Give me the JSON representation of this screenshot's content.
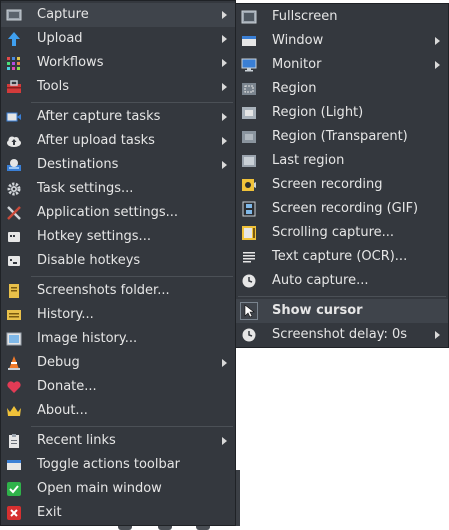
{
  "main_menu": {
    "items": [
      {
        "label": "Capture",
        "icon": "capture-icon",
        "submenu": true
      },
      {
        "label": "Upload",
        "icon": "upload-arrow-icon",
        "submenu": true
      },
      {
        "label": "Workflows",
        "icon": "workflows-grid-icon",
        "submenu": true
      },
      {
        "label": "Tools",
        "icon": "toolbox-icon",
        "submenu": true
      },
      {
        "label": "After capture tasks",
        "icon": "after-capture-icon",
        "submenu": true
      },
      {
        "label": "After upload tasks",
        "icon": "cloud-upload-icon",
        "submenu": true
      },
      {
        "label": "Destinations",
        "icon": "destinations-icon",
        "submenu": true
      },
      {
        "label": "Task settings...",
        "icon": "gear-icon",
        "submenu": false
      },
      {
        "label": "Application settings...",
        "icon": "wrench-screwdriver-icon",
        "submenu": false
      },
      {
        "label": "Hotkey settings...",
        "icon": "keyboard-icon",
        "submenu": false
      },
      {
        "label": "Disable hotkeys",
        "icon": "keyboard-disabled-icon",
        "submenu": false
      },
      {
        "label": "Screenshots folder...",
        "icon": "folder-icon",
        "submenu": false
      },
      {
        "label": "History...",
        "icon": "history-icon",
        "submenu": false
      },
      {
        "label": "Image history...",
        "icon": "image-history-icon",
        "submenu": false
      },
      {
        "label": "Debug",
        "icon": "traffic-cone-icon",
        "submenu": true
      },
      {
        "label": "Donate...",
        "icon": "heart-icon",
        "submenu": false
      },
      {
        "label": "About...",
        "icon": "crown-icon",
        "submenu": false
      },
      {
        "label": "Recent links",
        "icon": "clipboard-icon",
        "submenu": true
      },
      {
        "label": "Toggle actions toolbar",
        "icon": "toolbar-icon",
        "submenu": false
      },
      {
        "label": "Open main window",
        "icon": "green-check-icon",
        "submenu": false
      },
      {
        "label": "Exit",
        "icon": "red-x-icon",
        "submenu": false
      }
    ]
  },
  "capture_submenu": {
    "items": [
      {
        "label": "Fullscreen",
        "icon": "fullscreen-icon",
        "submenu": false
      },
      {
        "label": "Window",
        "icon": "window-icon",
        "submenu": true
      },
      {
        "label": "Monitor",
        "icon": "monitor-icon",
        "submenu": true
      },
      {
        "label": "Region",
        "icon": "region-icon",
        "submenu": false
      },
      {
        "label": "Region (Light)",
        "icon": "region-light-icon",
        "submenu": false
      },
      {
        "label": "Region (Transparent)",
        "icon": "region-transparent-icon",
        "submenu": false
      },
      {
        "label": "Last region",
        "icon": "last-region-icon",
        "submenu": false
      },
      {
        "label": "Screen recording",
        "icon": "screen-recording-icon",
        "submenu": false
      },
      {
        "label": "Screen recording (GIF)",
        "icon": "film-gif-icon",
        "submenu": false
      },
      {
        "label": "Scrolling capture...",
        "icon": "scrolling-capture-icon",
        "submenu": false
      },
      {
        "label": "Text capture (OCR)...",
        "icon": "ocr-icon",
        "submenu": false
      },
      {
        "label": "Auto capture...",
        "icon": "clock-icon",
        "submenu": false
      },
      {
        "label": "Show cursor",
        "icon": "cursor-icon",
        "submenu": false,
        "bold": true
      },
      {
        "label": "Screenshot delay: 0s",
        "icon": "clock-delay-icon",
        "submenu": true
      }
    ]
  },
  "colors": {
    "menu_bg": "#34383e",
    "highlight": "#3f444b",
    "separator": "#4b5056",
    "text": "#e6e6e6"
  }
}
